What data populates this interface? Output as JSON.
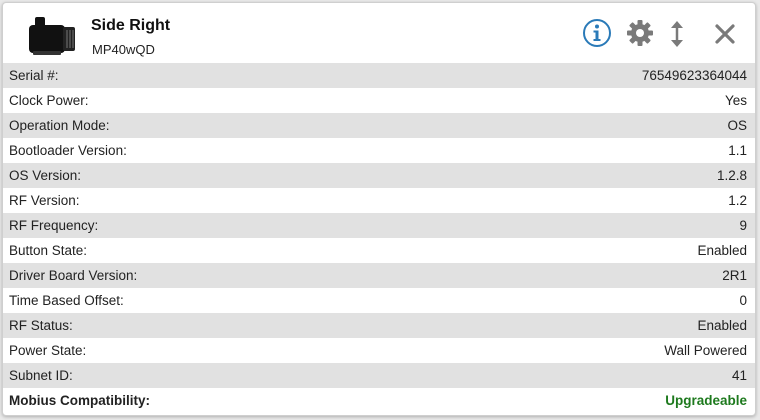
{
  "header": {
    "title": "Side Right",
    "subtitle": "MP40wQD"
  },
  "icons": {
    "device": "pump-device-icon",
    "info": "info-icon",
    "settings": "gear-icon",
    "resize": "vertical-resize-icon",
    "close": "close-icon"
  },
  "colors": {
    "info_accent": "#2a7ab8",
    "icon_gray": "#7a7a7a",
    "status_green": "#1e7a1e",
    "row_shade": "#e1e1e1"
  },
  "rows": [
    {
      "label": "Serial #:",
      "value": "76549623364044"
    },
    {
      "label": "Clock Power:",
      "value": "Yes"
    },
    {
      "label": "Operation Mode:",
      "value": "OS"
    },
    {
      "label": "Bootloader Version:",
      "value": "1.1"
    },
    {
      "label": "OS Version:",
      "value": "1.2.8"
    },
    {
      "label": "RF Version:",
      "value": "1.2"
    },
    {
      "label": "RF Frequency:",
      "value": "9"
    },
    {
      "label": "Button State:",
      "value": "Enabled"
    },
    {
      "label": "Driver Board Version:",
      "value": "2R1"
    },
    {
      "label": "Time Based Offset:",
      "value": "0"
    },
    {
      "label": "RF Status:",
      "value": "Enabled"
    },
    {
      "label": "Power State:",
      "value": "Wall Powered"
    },
    {
      "label": "Subnet ID:",
      "value": "41"
    },
    {
      "label": "Mobius Compatibility:",
      "value": "Upgradeable"
    }
  ]
}
